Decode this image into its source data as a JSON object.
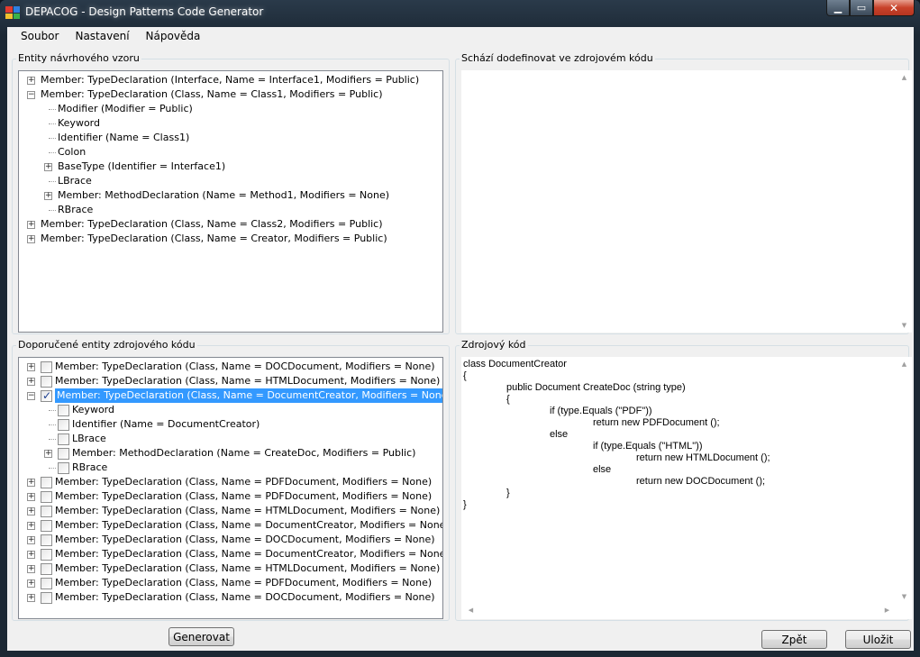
{
  "window": {
    "title": "DEPACOG - Design Patterns Code Generator",
    "minimize": "▁",
    "maximize": "▭",
    "close": "✕"
  },
  "menu": [
    "Soubor",
    "Nastavení",
    "Nápověda"
  ],
  "pattern_panel": {
    "label": "Entity návrhového vzoru",
    "rows": [
      {
        "text": "Member: TypeDeclaration (Interface, Name = Interface1, Modifiers = Public)",
        "expander": "+"
      },
      {
        "text": "Member: TypeDeclaration (Class, Name = Class1, Modifiers = Public)",
        "expander": "−"
      },
      {
        "text": "Modifier (Modifier = Public)",
        "expander": ""
      },
      {
        "text": "Keyword",
        "expander": ""
      },
      {
        "text": "Identifier (Name = Class1)",
        "expander": ""
      },
      {
        "text": "Colon",
        "expander": ""
      },
      {
        "text": "BaseType (Identifier = Interface1)",
        "expander": "+"
      },
      {
        "text": "LBrace",
        "expander": ""
      },
      {
        "text": "Member: MethodDeclaration (Name = Method1, Modifiers = None)",
        "expander": "+"
      },
      {
        "text": "RBrace",
        "expander": ""
      },
      {
        "text": "Member: TypeDeclaration (Class, Name = Class2, Modifiers = Public)",
        "expander": "+"
      },
      {
        "text": "Member: TypeDeclaration (Class, Name = Creator, Modifiers = Public)",
        "expander": "+"
      }
    ]
  },
  "missing_panel": {
    "label": "Schází dodefinovat ve zdrojovém kódu"
  },
  "recommended_panel": {
    "label": "Doporučené entity zdrojového kódu",
    "rows": [
      {
        "text": "Member: TypeDeclaration (Class, Name = DOCDocument, Modifiers = None)",
        "expander": "+",
        "checked": false
      },
      {
        "text": "Member: TypeDeclaration (Class, Name = HTMLDocument, Modifiers = None)",
        "expander": "+",
        "checked": false
      },
      {
        "text": "Member: TypeDeclaration (Class, Name = DocumentCreator, Modifiers = None)",
        "expander": "−",
        "checked": true,
        "selected": true
      },
      {
        "text": "Keyword",
        "expander": "",
        "checked": false
      },
      {
        "text": "Identifier (Name = DocumentCreator)",
        "expander": "",
        "checked": false
      },
      {
        "text": "LBrace",
        "expander": "",
        "checked": false
      },
      {
        "text": "Member: MethodDeclaration (Name = CreateDoc, Modifiers = Public)",
        "expander": "+",
        "checked": false
      },
      {
        "text": "RBrace",
        "expander": "",
        "checked": false
      },
      {
        "text": "Member: TypeDeclaration (Class, Name = PDFDocument, Modifiers = None)",
        "expander": "+",
        "checked": false
      },
      {
        "text": "Member: TypeDeclaration (Class, Name = PDFDocument, Modifiers = None)",
        "expander": "+",
        "checked": false
      },
      {
        "text": "Member: TypeDeclaration (Class, Name = HTMLDocument, Modifiers = None)",
        "expander": "+",
        "checked": false
      },
      {
        "text": "Member: TypeDeclaration (Class, Name = DocumentCreator, Modifiers = None)",
        "expander": "+",
        "checked": false
      },
      {
        "text": "Member: TypeDeclaration (Class, Name = DOCDocument, Modifiers = None)",
        "expander": "+",
        "checked": false
      },
      {
        "text": "Member: TypeDeclaration (Class, Name = DocumentCreator, Modifiers = None)",
        "expander": "+",
        "checked": false
      },
      {
        "text": "Member: TypeDeclaration (Class, Name = HTMLDocument, Modifiers = None)",
        "expander": "+",
        "checked": false
      },
      {
        "text": "Member: TypeDeclaration (Class, Name = PDFDocument, Modifiers = None)",
        "expander": "+",
        "checked": false
      },
      {
        "text": "Member: TypeDeclaration (Class, Name = DOCDocument, Modifiers = None)",
        "expander": "+",
        "checked": false
      }
    ]
  },
  "source_panel": {
    "label": "Zdrojový kód",
    "lines": [
      "class DocumentCreator",
      "{",
      "\t\tpublic Document CreateDoc (string type)",
      "\t\t{",
      "\t\t\t\tif (type.Equals (\"PDF\"))",
      "\t\t\t\t\t\treturn new PDFDocument ();",
      "\t\t\t\telse",
      "\t\t\t\t\t\tif (type.Equals (\"HTML\"))",
      "\t\t\t\t\t\t\t\treturn new HTMLDocument ();",
      "\t\t\t\t\t\telse",
      "\t\t\t\t\t\t\t\treturn new DOCDocument ();",
      "\t\t}",
      "}"
    ]
  },
  "buttons": {
    "generate": "Generovat",
    "back": "Zpět",
    "save": "Uložit"
  },
  "colors": {
    "selection": "#3399ff",
    "window_frame": "#1c2834",
    "client_bg": "#f0f0f0"
  }
}
